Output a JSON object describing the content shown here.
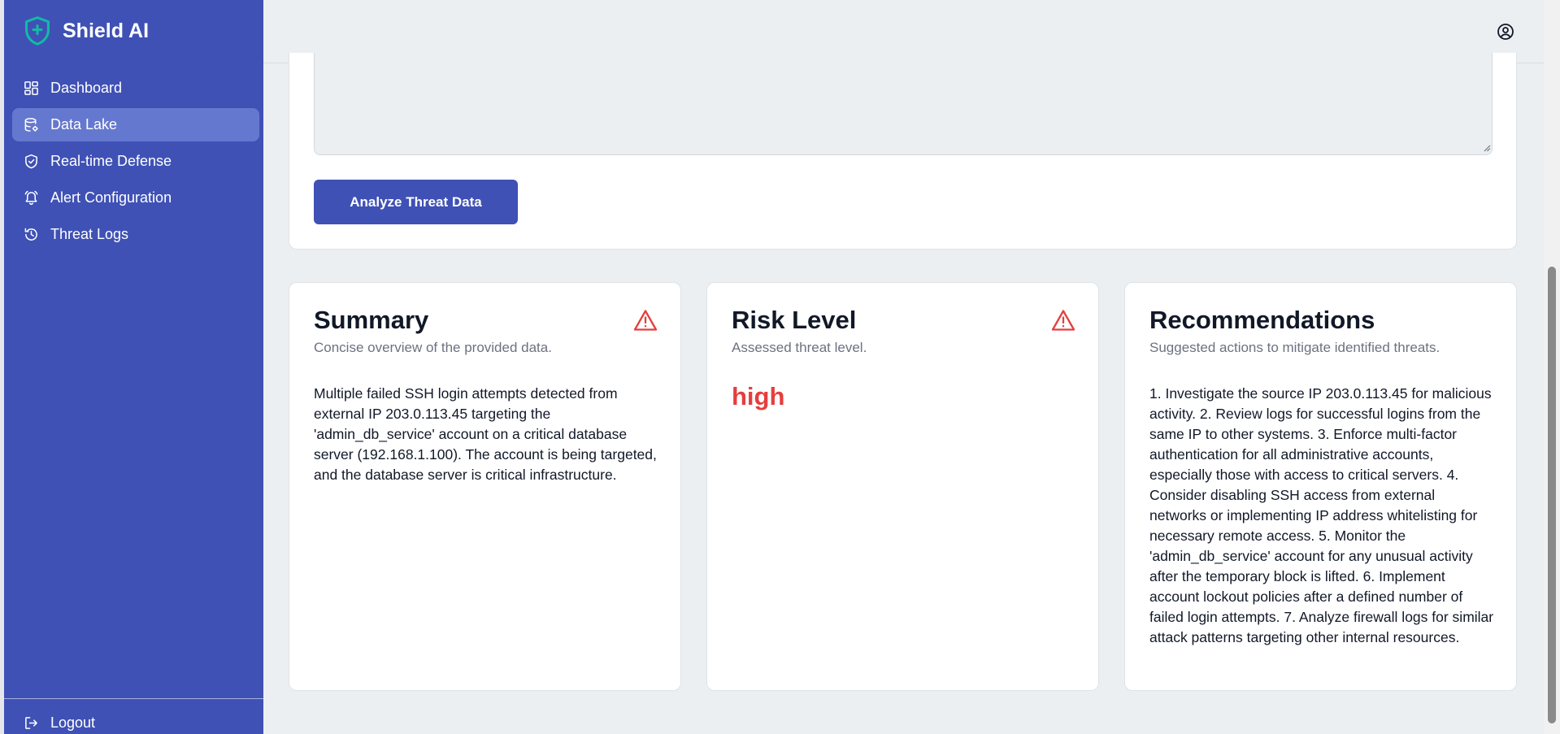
{
  "app": {
    "name": "Shield AI"
  },
  "sidebar": {
    "items": [
      {
        "label": "Dashboard",
        "icon": "dashboard-icon"
      },
      {
        "label": "Data Lake",
        "icon": "database-icon",
        "active": true
      },
      {
        "label": "Real-time Defense",
        "icon": "shield-check-icon"
      },
      {
        "label": "Alert Configuration",
        "icon": "bell-icon"
      },
      {
        "label": "Threat Logs",
        "icon": "history-icon"
      }
    ],
    "logout_label": "Logout"
  },
  "header": {
    "user_icon": "user-circle-icon"
  },
  "form": {
    "textarea_value": "",
    "analyze_label": "Analyze Threat Data"
  },
  "summary": {
    "title": "Summary",
    "subtitle": "Concise overview of the provided data.",
    "body": "Multiple failed SSH login attempts detected from external IP 203.0.113.45 targeting the 'admin_db_service' account on a critical database server (192.168.1.100). The account is being targeted, and the database server is critical infrastructure.",
    "icon": "warning-icon"
  },
  "risk": {
    "title": "Risk Level",
    "subtitle": "Assessed threat level.",
    "value": "high",
    "icon": "warning-icon"
  },
  "recommendations": {
    "title": "Recommendations",
    "subtitle": "Suggested actions to mitigate identified threats.",
    "body": "1. Investigate the source IP 203.0.113.45 for malicious activity. 2. Review logs for successful logins from the same IP to other systems. 3. Enforce multi-factor authentication for all administrative accounts, especially those with access to critical servers. 4. Consider disabling SSH access from external networks or implementing IP address whitelisting for necessary remote access. 5. Monitor the 'admin_db_service' account for any unusual activity after the temporary block is lifted. 6. Implement account lockout policies after a defined number of failed login attempts. 7. Analyze firewall logs for similar attack patterns targeting other internal resources."
  },
  "colors": {
    "sidebar_bg": "#3f51b5",
    "active_item_bg": "#6578cf",
    "danger": "#e53e3e",
    "logo_accent": "#14b8a6"
  }
}
